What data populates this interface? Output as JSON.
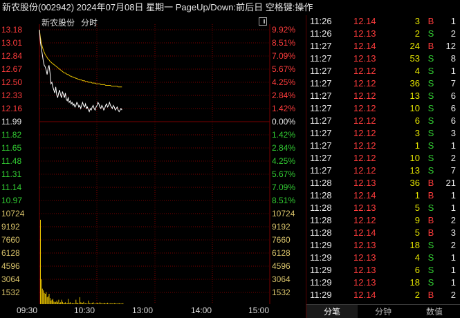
{
  "title_bar": "新农股份(002942)  2024年07月08日  星期一  PageUp/Down:前后日  空格键:操作",
  "chart": {
    "name": "新农股份",
    "period": "分时",
    "price_ticks": [
      "13.18",
      "13.01",
      "12.84",
      "12.67",
      "12.50",
      "12.33",
      "12.16",
      "11.99",
      "11.82",
      "11.65",
      "11.48",
      "11.31",
      "11.14",
      "10.97"
    ],
    "pct_ticks": [
      "9.92%",
      "8.51%",
      "7.09%",
      "5.67%",
      "4.25%",
      "2.84%",
      "1.42%",
      "0.00%",
      "1.42%",
      "2.84%",
      "4.25%",
      "5.67%",
      "7.09%",
      "8.51%"
    ],
    "volume_ticks": [
      "10724",
      "9192",
      "7660",
      "6128",
      "4596",
      "3064",
      "1532"
    ],
    "time_ticks": [
      "09:30",
      "10:30",
      "13:00",
      "14:00",
      "15:00"
    ],
    "prev_close": 11.99,
    "price_range": [
      10.97,
      13.18
    ],
    "volume_max": 10724,
    "price_series": [
      13.18,
      13.02,
      12.94,
      12.86,
      12.78,
      12.72,
      12.7,
      12.66,
      12.6,
      12.68,
      12.72,
      12.62,
      12.48,
      12.5,
      12.44,
      12.4,
      12.36,
      12.44,
      12.34,
      12.3,
      12.36,
      12.4,
      12.34,
      12.3,
      12.38,
      12.34,
      12.3,
      12.36,
      12.28,
      12.26,
      12.3,
      12.24,
      12.26,
      12.22,
      12.24,
      12.2,
      12.22,
      12.18,
      12.2,
      12.24,
      12.22,
      12.18,
      12.2,
      12.16,
      12.2,
      12.24,
      12.2,
      12.18,
      12.22,
      12.16,
      12.18,
      12.14,
      12.12,
      12.16,
      12.14,
      12.18,
      12.2,
      12.16,
      12.14,
      12.18,
      12.2,
      12.24,
      12.22,
      12.18,
      12.16,
      12.2,
      12.18,
      12.14,
      12.16,
      12.2,
      12.22,
      12.18,
      12.2,
      12.24,
      12.2,
      12.18,
      12.16,
      12.2,
      12.18,
      12.14,
      12.16,
      12.18,
      12.14,
      12.12,
      12.14,
      12.16,
      12.14
    ],
    "avg_series": [
      13.18,
      13.08,
      13.01,
      12.96,
      12.92,
      12.89,
      12.86,
      12.84,
      12.82,
      12.8,
      12.79,
      12.77,
      12.76,
      12.75,
      12.74,
      12.73,
      12.72,
      12.71,
      12.7,
      12.69,
      12.68,
      12.67,
      12.66,
      12.65,
      12.64,
      12.63,
      12.62,
      12.62,
      12.61,
      12.6,
      12.6,
      12.59,
      12.58,
      12.58,
      12.57,
      12.57,
      12.56,
      12.56,
      12.55,
      12.55,
      12.54,
      12.54,
      12.53,
      12.53,
      12.53,
      12.52,
      12.52,
      12.52,
      12.51,
      12.51,
      12.51,
      12.5,
      12.5,
      12.5,
      12.5,
      12.49,
      12.49,
      12.49,
      12.49,
      12.48,
      12.48,
      12.48,
      12.48,
      12.48,
      12.47,
      12.47,
      12.47,
      12.47,
      12.47,
      12.46,
      12.46,
      12.46,
      12.46,
      12.46,
      12.46,
      12.45,
      12.45,
      12.45,
      12.45,
      12.45,
      12.45,
      12.45,
      12.44,
      12.44,
      12.44,
      12.44,
      12.44
    ],
    "volume_series": [
      10000,
      3000,
      1900,
      1700,
      1400,
      1300,
      1500,
      900,
      1000,
      1300,
      800,
      500,
      600,
      700,
      400,
      300,
      350,
      500,
      300,
      600,
      250,
      300,
      600,
      350,
      200,
      250,
      300,
      180,
      200,
      700,
      250,
      300,
      150,
      200,
      220,
      180,
      150,
      600,
      250,
      200,
      150,
      900,
      300,
      250,
      200,
      350,
      150,
      200,
      180,
      120,
      500,
      200,
      150,
      180,
      220,
      300,
      150,
      120,
      200,
      250,
      180,
      150,
      300,
      200,
      180,
      150,
      200,
      220,
      160,
      180,
      250,
      150,
      140,
      200,
      180,
      160,
      150,
      220,
      180,
      160,
      140,
      180,
      200,
      150,
      160,
      140,
      200
    ],
    "colors": {
      "up": "#ff3c3c",
      "down": "#32cd32",
      "price_line": "#ffffff",
      "avg_line": "#e6c000",
      "grid": "#7a0000",
      "volume": "#e6c000"
    }
  },
  "ticks": [
    {
      "time": "11:26",
      "price": "12.14",
      "volume": "3",
      "side": "B",
      "count": "1"
    },
    {
      "time": "11:26",
      "price": "12.13",
      "volume": "2",
      "side": "S",
      "count": "2"
    },
    {
      "time": "11:27",
      "price": "12.14",
      "volume": "24",
      "side": "B",
      "count": "12"
    },
    {
      "time": "11:27",
      "price": "12.13",
      "volume": "53",
      "side": "S",
      "count": "8"
    },
    {
      "time": "11:27",
      "price": "12.12",
      "volume": "4",
      "side": "S",
      "count": "1"
    },
    {
      "time": "11:27",
      "price": "12.12",
      "volume": "36",
      "side": "S",
      "count": "7"
    },
    {
      "time": "11:27",
      "price": "12.12",
      "volume": "13",
      "side": "S",
      "count": "6"
    },
    {
      "time": "11:27",
      "price": "12.12",
      "volume": "10",
      "side": "S",
      "count": "6"
    },
    {
      "time": "11:27",
      "price": "12.12",
      "volume": "6",
      "side": "S",
      "count": "6"
    },
    {
      "time": "11:27",
      "price": "12.12",
      "volume": "3",
      "side": "S",
      "count": "3"
    },
    {
      "time": "11:27",
      "price": "12.12",
      "volume": "1",
      "side": "S",
      "count": "1"
    },
    {
      "time": "11:27",
      "price": "12.12",
      "volume": "10",
      "side": "S",
      "count": "2"
    },
    {
      "time": "11:27",
      "price": "12.12",
      "volume": "13",
      "side": "S",
      "count": "7"
    },
    {
      "time": "11:28",
      "price": "12.13",
      "volume": "36",
      "side": "B",
      "count": "21"
    },
    {
      "time": "11:28",
      "price": "12.14",
      "volume": "1",
      "side": "B",
      "count": "1"
    },
    {
      "time": "11:28",
      "price": "12.13",
      "volume": "5",
      "side": "S",
      "count": "1"
    },
    {
      "time": "11:28",
      "price": "12.12",
      "volume": "9",
      "side": "B",
      "count": "2"
    },
    {
      "time": "11:28",
      "price": "12.14",
      "volume": "5",
      "side": "B",
      "count": "3"
    },
    {
      "time": "11:29",
      "price": "12.13",
      "volume": "18",
      "side": "S",
      "count": "2"
    },
    {
      "time": "11:29",
      "price": "12.13",
      "volume": "4",
      "side": "S",
      "count": "1"
    },
    {
      "time": "11:29",
      "price": "12.13",
      "volume": "6",
      "side": "S",
      "count": "1"
    },
    {
      "time": "11:29",
      "price": "12.13",
      "volume": "18",
      "side": "S",
      "count": "1"
    },
    {
      "time": "11:29",
      "price": "12.14",
      "volume": "2",
      "side": "B",
      "count": "2"
    }
  ],
  "tabs": [
    "分笔",
    "分钟",
    "数值"
  ]
}
